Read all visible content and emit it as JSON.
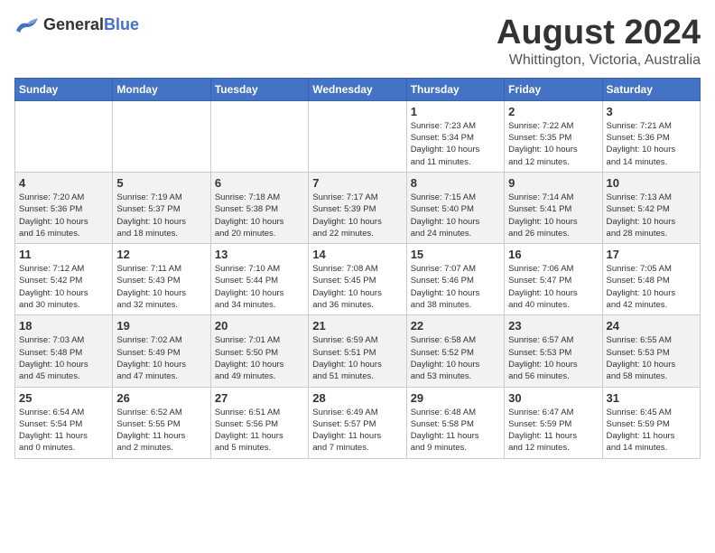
{
  "header": {
    "logo_general": "General",
    "logo_blue": "Blue",
    "month_year": "August 2024",
    "location": "Whittington, Victoria, Australia"
  },
  "calendar": {
    "days_of_week": [
      "Sunday",
      "Monday",
      "Tuesday",
      "Wednesday",
      "Thursday",
      "Friday",
      "Saturday"
    ],
    "weeks": [
      [
        {
          "day": "",
          "info": ""
        },
        {
          "day": "",
          "info": ""
        },
        {
          "day": "",
          "info": ""
        },
        {
          "day": "",
          "info": ""
        },
        {
          "day": "1",
          "info": "Sunrise: 7:23 AM\nSunset: 5:34 PM\nDaylight: 10 hours\nand 11 minutes."
        },
        {
          "day": "2",
          "info": "Sunrise: 7:22 AM\nSunset: 5:35 PM\nDaylight: 10 hours\nand 12 minutes."
        },
        {
          "day": "3",
          "info": "Sunrise: 7:21 AM\nSunset: 5:36 PM\nDaylight: 10 hours\nand 14 minutes."
        }
      ],
      [
        {
          "day": "4",
          "info": "Sunrise: 7:20 AM\nSunset: 5:36 PM\nDaylight: 10 hours\nand 16 minutes."
        },
        {
          "day": "5",
          "info": "Sunrise: 7:19 AM\nSunset: 5:37 PM\nDaylight: 10 hours\nand 18 minutes."
        },
        {
          "day": "6",
          "info": "Sunrise: 7:18 AM\nSunset: 5:38 PM\nDaylight: 10 hours\nand 20 minutes."
        },
        {
          "day": "7",
          "info": "Sunrise: 7:17 AM\nSunset: 5:39 PM\nDaylight: 10 hours\nand 22 minutes."
        },
        {
          "day": "8",
          "info": "Sunrise: 7:15 AM\nSunset: 5:40 PM\nDaylight: 10 hours\nand 24 minutes."
        },
        {
          "day": "9",
          "info": "Sunrise: 7:14 AM\nSunset: 5:41 PM\nDaylight: 10 hours\nand 26 minutes."
        },
        {
          "day": "10",
          "info": "Sunrise: 7:13 AM\nSunset: 5:42 PM\nDaylight: 10 hours\nand 28 minutes."
        }
      ],
      [
        {
          "day": "11",
          "info": "Sunrise: 7:12 AM\nSunset: 5:42 PM\nDaylight: 10 hours\nand 30 minutes."
        },
        {
          "day": "12",
          "info": "Sunrise: 7:11 AM\nSunset: 5:43 PM\nDaylight: 10 hours\nand 32 minutes."
        },
        {
          "day": "13",
          "info": "Sunrise: 7:10 AM\nSunset: 5:44 PM\nDaylight: 10 hours\nand 34 minutes."
        },
        {
          "day": "14",
          "info": "Sunrise: 7:08 AM\nSunset: 5:45 PM\nDaylight: 10 hours\nand 36 minutes."
        },
        {
          "day": "15",
          "info": "Sunrise: 7:07 AM\nSunset: 5:46 PM\nDaylight: 10 hours\nand 38 minutes."
        },
        {
          "day": "16",
          "info": "Sunrise: 7:06 AM\nSunset: 5:47 PM\nDaylight: 10 hours\nand 40 minutes."
        },
        {
          "day": "17",
          "info": "Sunrise: 7:05 AM\nSunset: 5:48 PM\nDaylight: 10 hours\nand 42 minutes."
        }
      ],
      [
        {
          "day": "18",
          "info": "Sunrise: 7:03 AM\nSunset: 5:48 PM\nDaylight: 10 hours\nand 45 minutes."
        },
        {
          "day": "19",
          "info": "Sunrise: 7:02 AM\nSunset: 5:49 PM\nDaylight: 10 hours\nand 47 minutes."
        },
        {
          "day": "20",
          "info": "Sunrise: 7:01 AM\nSunset: 5:50 PM\nDaylight: 10 hours\nand 49 minutes."
        },
        {
          "day": "21",
          "info": "Sunrise: 6:59 AM\nSunset: 5:51 PM\nDaylight: 10 hours\nand 51 minutes."
        },
        {
          "day": "22",
          "info": "Sunrise: 6:58 AM\nSunset: 5:52 PM\nDaylight: 10 hours\nand 53 minutes."
        },
        {
          "day": "23",
          "info": "Sunrise: 6:57 AM\nSunset: 5:53 PM\nDaylight: 10 hours\nand 56 minutes."
        },
        {
          "day": "24",
          "info": "Sunrise: 6:55 AM\nSunset: 5:53 PM\nDaylight: 10 hours\nand 58 minutes."
        }
      ],
      [
        {
          "day": "25",
          "info": "Sunrise: 6:54 AM\nSunset: 5:54 PM\nDaylight: 11 hours\nand 0 minutes."
        },
        {
          "day": "26",
          "info": "Sunrise: 6:52 AM\nSunset: 5:55 PM\nDaylight: 11 hours\nand 2 minutes."
        },
        {
          "day": "27",
          "info": "Sunrise: 6:51 AM\nSunset: 5:56 PM\nDaylight: 11 hours\nand 5 minutes."
        },
        {
          "day": "28",
          "info": "Sunrise: 6:49 AM\nSunset: 5:57 PM\nDaylight: 11 hours\nand 7 minutes."
        },
        {
          "day": "29",
          "info": "Sunrise: 6:48 AM\nSunset: 5:58 PM\nDaylight: 11 hours\nand 9 minutes."
        },
        {
          "day": "30",
          "info": "Sunrise: 6:47 AM\nSunset: 5:59 PM\nDaylight: 11 hours\nand 12 minutes."
        },
        {
          "day": "31",
          "info": "Sunrise: 6:45 AM\nSunset: 5:59 PM\nDaylight: 11 hours\nand 14 minutes."
        }
      ]
    ]
  }
}
